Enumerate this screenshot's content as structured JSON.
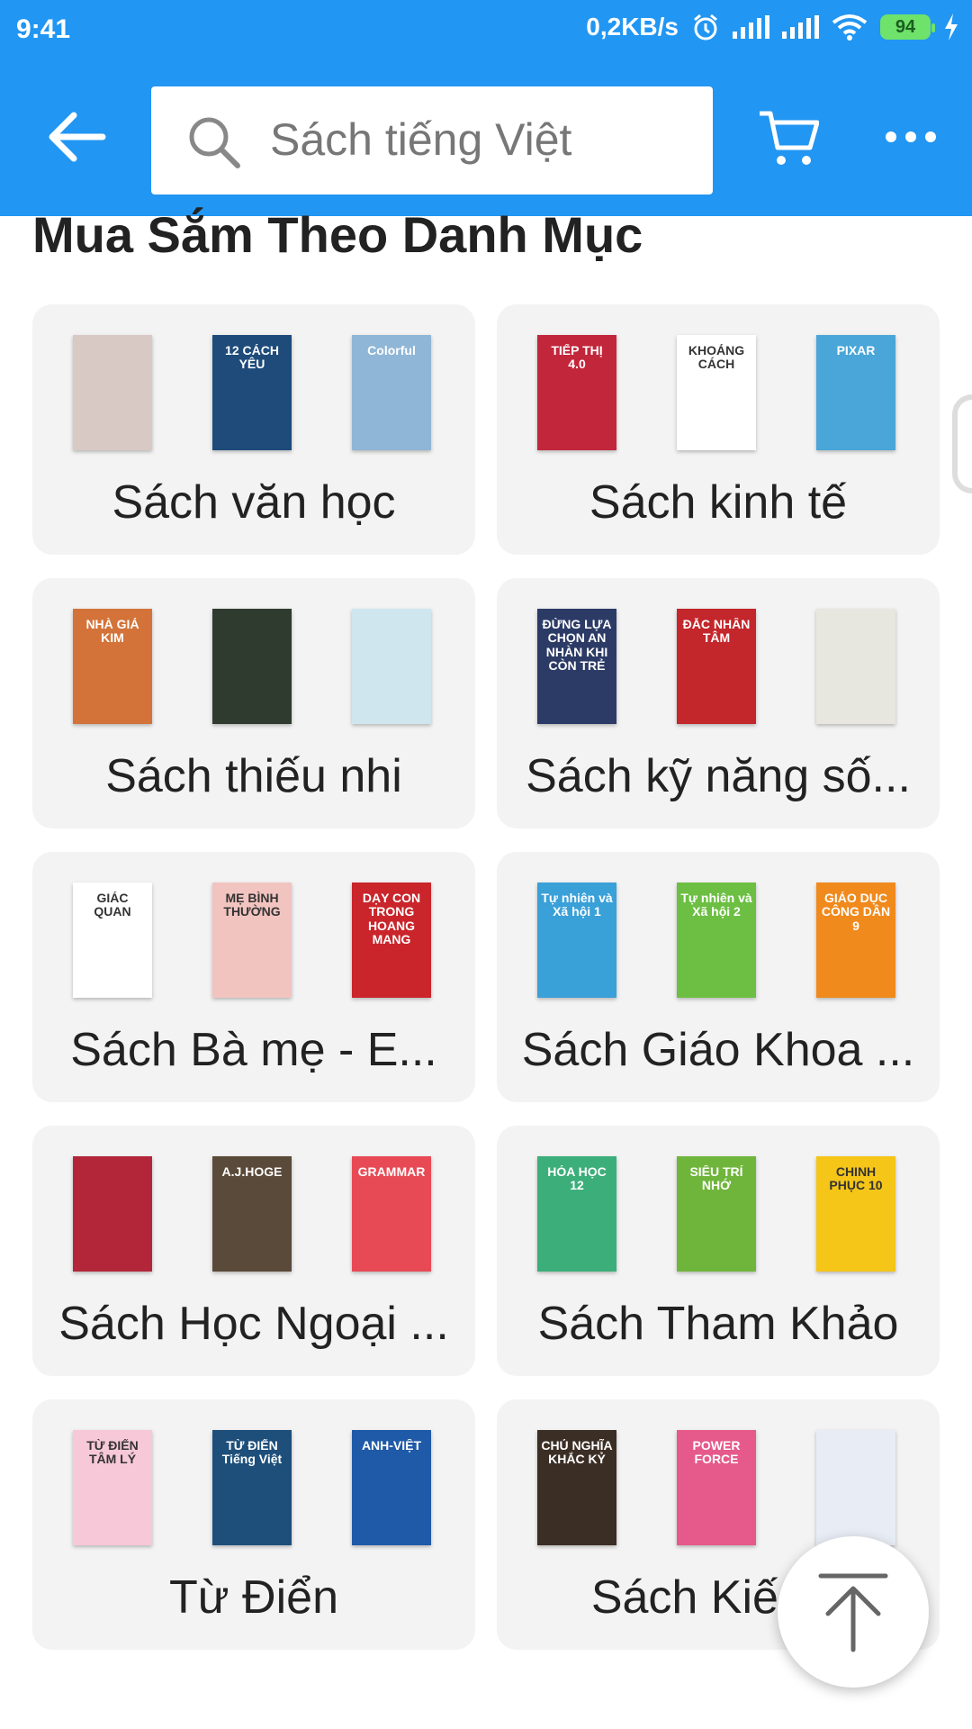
{
  "status_bar": {
    "time": "9:41",
    "network_speed": "0,2KB/s",
    "battery_level": "94",
    "icons": [
      "alarm-icon",
      "signal-icon",
      "signal-icon",
      "wifi-icon",
      "battery-icon",
      "charging-icon"
    ]
  },
  "toolbar": {
    "back_icon": "arrow-left-icon",
    "search_placeholder": "Sách tiếng Việt",
    "cart_icon": "cart-icon",
    "more_icon": "more-horizontal-icon"
  },
  "section": {
    "title": "Mua Sắm Theo Danh Mục"
  },
  "categories": [
    {
      "label": "Sách văn học",
      "books": [
        {
          "title": "",
          "color": "#d9c9c4"
        },
        {
          "title": "12 CÁCH YÊU",
          "color": "#1e4b7a"
        },
        {
          "title": "Colorful",
          "color": "#8fb6d6"
        }
      ]
    },
    {
      "label": "Sách kinh tế",
      "books": [
        {
          "title": "TIẾP THỊ 4.0",
          "color": "#c2263b"
        },
        {
          "title": "KHOẢNG CÁCH",
          "color": "#ffffff"
        },
        {
          "title": "PIXAR",
          "color": "#4aa6d8"
        }
      ]
    },
    {
      "label": "Sách thiếu nhi",
      "books": [
        {
          "title": "NHÀ GIẢ KIM",
          "color": "#d3733a"
        },
        {
          "title": "",
          "color": "#2f3b2f"
        },
        {
          "title": "",
          "color": "#cfe6ef"
        }
      ]
    },
    {
      "label": "Sách kỹ năng số...",
      "books": [
        {
          "title": "ĐỪNG LỰA CHỌN AN NHÀN KHI CÒN TRẺ",
          "color": "#2c3b66"
        },
        {
          "title": "ĐẮC NHÂN TÂM",
          "color": "#c3262b"
        },
        {
          "title": "",
          "color": "#e7e7e0"
        }
      ]
    },
    {
      "label": "Sách Bà mẹ - E...",
      "books": [
        {
          "title": "GIÁC QUAN",
          "color": "#ffffff"
        },
        {
          "title": "MẸ BÌNH THƯỜNG",
          "color": "#f2c4c0"
        },
        {
          "title": "DẠY CON TRONG HOANG MANG",
          "color": "#c9252b"
        }
      ]
    },
    {
      "label": "Sách Giáo Khoa ...",
      "books": [
        {
          "title": "Tự nhiên và Xã hội 1",
          "color": "#3aa0d8"
        },
        {
          "title": "Tự nhiên và Xã hội 2",
          "color": "#6cbf43"
        },
        {
          "title": "GIÁO DỤC CÔNG DÂN 9",
          "color": "#f08a1c"
        }
      ]
    },
    {
      "label": "Sách Học Ngoại ...",
      "books": [
        {
          "title": "",
          "color": "#b3263a"
        },
        {
          "title": "A.J.HOGE",
          "color": "#5a4a3a"
        },
        {
          "title": "GRAMMAR",
          "color": "#e84a55"
        }
      ]
    },
    {
      "label": "Sách Tham Khảo",
      "books": [
        {
          "title": "HÓA HỌC 12",
          "color": "#3cae7a"
        },
        {
          "title": "SIÊU TRÍ NHỚ",
          "color": "#6fb53b"
        },
        {
          "title": "CHINH PHỤC 10",
          "color": "#f5c518"
        }
      ]
    },
    {
      "label": "Từ Điển",
      "books": [
        {
          "title": "TỪ ĐIỂN TÂM LÝ",
          "color": "#f7c8d8"
        },
        {
          "title": "TỪ ĐIỂN Tiếng Việt",
          "color": "#1d4f7a"
        },
        {
          "title": "ANH-VIỆT",
          "color": "#1f5aa8"
        }
      ]
    },
    {
      "label": "Sách Kiến T",
      "books": [
        {
          "title": "CHỦ NGHĨA KHẮC KỶ",
          "color": "#3b2e25"
        },
        {
          "title": "POWER FORCE",
          "color": "#e55a8a"
        },
        {
          "title": "",
          "color": "#e8ecf4"
        }
      ]
    }
  ],
  "scroll_top_icon": "arrow-up-to-top-icon"
}
